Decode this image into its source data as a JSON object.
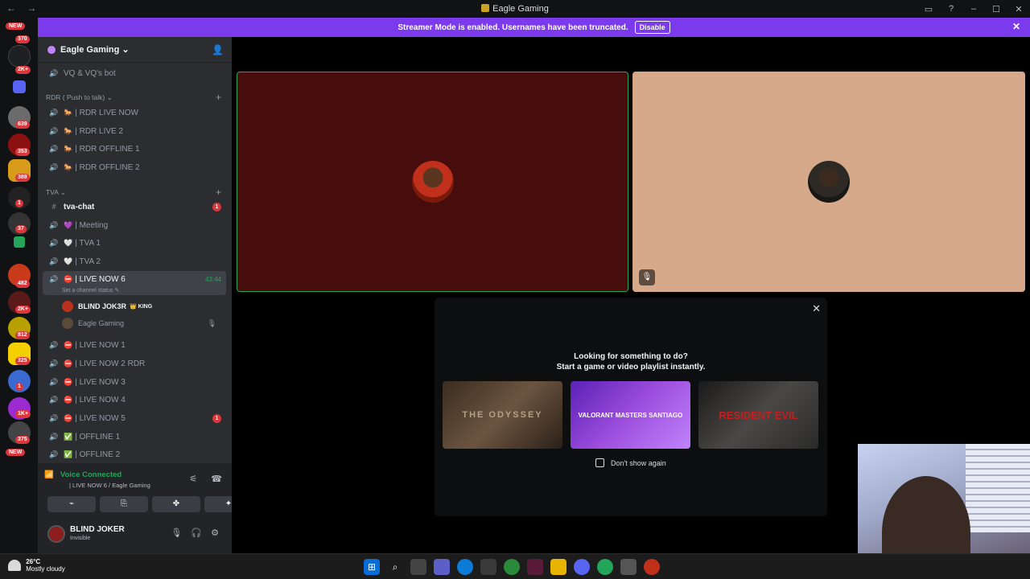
{
  "window": {
    "title": "Eagle Gaming",
    "nav_back": "←",
    "nav_forward": "→",
    "controls": [
      "▭",
      "?",
      "–",
      "☐",
      "✕"
    ]
  },
  "banner": {
    "text": "Streamer Mode is enabled. Usernames have been truncated.",
    "button": "Disable",
    "close": "✕"
  },
  "servers": {
    "badges": [
      "NEW",
      "370",
      "2K+",
      "639",
      "353",
      "389",
      "1",
      "37",
      "482",
      "2K+",
      "812",
      "325",
      "1",
      "1K+",
      "375",
      "NEW"
    ]
  },
  "sidebar": {
    "server_name": "Eagle Gaming ⌄",
    "invite_icon": "👤",
    "top_channel": "VQ & VQ's bot",
    "cat_rdr": "RDR ( Push to talk) ⌄",
    "rdr_channels": [
      "| RDR LIVE NOW",
      "| RDR LIVE 2",
      "| RDR OFFLINE 1",
      "| RDR OFFLINE 2"
    ],
    "cat_tva": "TVA ⌄",
    "text_channel": "tva-chat",
    "text_badge": "1",
    "tva_channels": [
      "| Meeting",
      "| TVA 1",
      "| TVA 2"
    ],
    "active_channel": "| LIVE NOW 6",
    "active_timer": "43:44",
    "active_status": "Set a channel status ✎",
    "members": [
      {
        "name": "BLIND JOK3R",
        "tag": "👑 KING"
      },
      {
        "name": "Eagle Gaming",
        "tag": ""
      }
    ],
    "live_channels": [
      "| LIVE NOW 1",
      "| LIVE NOW 2 RDR",
      "| LIVE NOW 3",
      "| LIVE NOW 4",
      "| LIVE NOW 5"
    ],
    "live5_badge": "1",
    "offline_channels": [
      "| OFFLINE 1",
      "| OFFLINE 2"
    ]
  },
  "voice": {
    "status": "Voice Connected",
    "sub": "| LIVE NOW 6 / Eagle Gaming",
    "buttons": [
      "⌁",
      "⎘",
      "✤",
      "✦"
    ]
  },
  "user": {
    "name": "BLIND JOKER",
    "status": "Invisible"
  },
  "activity": {
    "title": "Looking for something to do?",
    "subtitle": "Start a game or video playlist instantly.",
    "cards": [
      "THE ODYSSEY",
      "VALORANT MASTERS SANTIAGO",
      "RESIDENT EVIL"
    ],
    "checkbox_label": "Don't show again",
    "close": "✕"
  },
  "taskbar": {
    "temp": "26°C",
    "weather": "Mostly cloudy"
  },
  "colors": {
    "accent": "#7c3aed",
    "tile1": "#470c0c",
    "tile2": "#d6a98a",
    "speaking": "#23a55a"
  }
}
